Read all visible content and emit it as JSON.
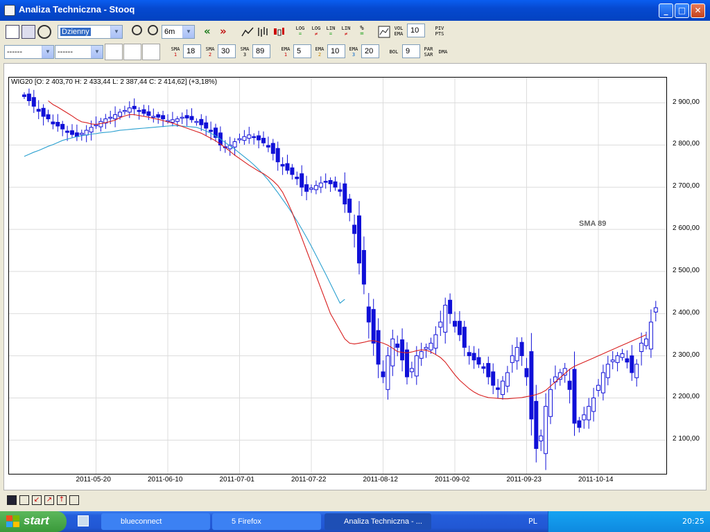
{
  "window": {
    "title": "Analiza Techniczna - Stooq"
  },
  "toolbar1": {
    "interval": "Dzienny",
    "range": "6m",
    "log_label": "LOG",
    "log_ne_label": "LOG",
    "lin_label": "LIN",
    "lin_ne_label": "LIN",
    "percent_label": "%",
    "vol_label": "VOL",
    "ema_label": "EMA",
    "vol_value": "10",
    "piv_label": "PIV",
    "pts_label": "PTS"
  },
  "toolbar2": {
    "combo1": "------",
    "combo2": "------",
    "sma_label": "SMA",
    "sma1_idx": "1",
    "sma1": "18",
    "sma2_idx": "2",
    "sma2": "30",
    "sma3_idx": "3",
    "sma3": "89",
    "ema_label": "EMA",
    "ema1_idx": "1",
    "ema1": "5",
    "ema2_idx": "2",
    "ema2": "10",
    "ema3_idx": "3",
    "ema3": "20",
    "bol_label": "BOL",
    "bol": "9",
    "par_label": "PAR",
    "sar_label": "SAR",
    "dma_label": "DMA"
  },
  "chart_data": {
    "type": "candlestick",
    "header": "WIG20 [O: 2 403,70  H: 2 433,44  L: 2 387,44  C: 2 414,62] (+3,18%)",
    "annotation": "SMA 89",
    "ylim": [
      2020,
      2960
    ],
    "y_ticks": [
      2900,
      2800,
      2700,
      2600,
      2500,
      2400,
      2300,
      2200,
      2100
    ],
    "y_tick_labels": [
      "2 900,00",
      "2 800,00",
      "2 700,00",
      "2 600,00",
      "2 500,00",
      "2 400,00",
      "2 300,00",
      "2 200,00",
      "2 100,00"
    ],
    "x_ticks": [
      "2011-05-20",
      "2011-06-10",
      "2011-07-01",
      "2011-07-22",
      "2011-08-12",
      "2011-09-02",
      "2011-09-23",
      "2011-10-14"
    ],
    "x_tick_index": [
      15,
      30,
      45,
      60,
      75,
      90,
      105,
      120
    ],
    "n_bars": 131,
    "grid": true,
    "colors": {
      "up": "#ffffff",
      "down": "#1010d8",
      "outline": "#1010d8",
      "sma_short": "#d81e1e",
      "sma89": "#2aa0d0"
    },
    "closes": [
      2915,
      2905,
      2892,
      2880,
      2868,
      2862,
      2850,
      2845,
      2838,
      2830,
      2825,
      2820,
      2828,
      2835,
      2842,
      2848,
      2856,
      2862,
      2866,
      2872,
      2878,
      2882,
      2888,
      2886,
      2880,
      2875,
      2870,
      2868,
      2866,
      2862,
      2858,
      2860,
      2862,
      2866,
      2864,
      2860,
      2856,
      2848,
      2840,
      2832,
      2818,
      2800,
      2795,
      2800,
      2808,
      2815,
      2820,
      2824,
      2818,
      2812,
      2805,
      2795,
      2780,
      2760,
      2750,
      2740,
      2730,
      2720,
      2700,
      2690,
      2698,
      2704,
      2710,
      2712,
      2708,
      2700,
      2690,
      2660,
      2640,
      2590,
      2520,
      2470,
      2380,
      2330,
      2280,
      2250,
      2300,
      2340,
      2320,
      2290,
      2250,
      2270,
      2300,
      2310,
      2320,
      2330,
      2350,
      2380,
      2420,
      2400,
      2370,
      2350,
      2320,
      2300,
      2290,
      2280,
      2270,
      2250,
      2230,
      2220,
      2240,
      2260,
      2300,
      2320,
      2300,
      2250,
      2150,
      2080,
      2110,
      2180,
      2220,
      2250,
      2260,
      2270,
      2220,
      2140,
      2130,
      2160,
      2180,
      2200,
      2230,
      2260,
      2280,
      2290,
      2300,
      2305,
      2285,
      2260,
      2280,
      2330,
      2340,
      2380,
      2414
    ],
    "sma_short": {
      "first_index": 5,
      "values": [
        2905,
        2896,
        2890,
        2883,
        2876,
        2869,
        2861,
        2855,
        2853,
        2850,
        2849,
        2851,
        2853,
        2856,
        2859,
        2865,
        2869,
        2872,
        2872,
        2870,
        2868,
        2866,
        2863,
        2861,
        2858,
        2855,
        2852,
        2848,
        2844,
        2840,
        2836,
        2832,
        2828,
        2822,
        2816,
        2810,
        2802,
        2794,
        2785,
        2776,
        2768,
        2760,
        2752,
        2745,
        2738,
        2732,
        2724,
        2715,
        2704,
        2688,
        2665,
        2640,
        2610,
        2580,
        2550,
        2520,
        2490,
        2460,
        2430,
        2400,
        2380,
        2360,
        2340,
        2330,
        2328,
        2330,
        2332,
        2335,
        2336,
        2333,
        2330,
        2325,
        2318,
        2310,
        2308,
        2307,
        2309,
        2312,
        2314,
        2313,
        2309,
        2303,
        2296,
        2285,
        2270,
        2255,
        2242,
        2232,
        2222,
        2214,
        2208,
        2204,
        2201,
        2200,
        2199,
        2198,
        2198,
        2199,
        2200,
        2201,
        2203,
        2205,
        2208,
        2212,
        2218,
        2228,
        2238,
        2248,
        2258,
        2268,
        2275,
        2280,
        2285,
        2290,
        2295,
        2300,
        2305,
        2310,
        2315,
        2320,
        2325,
        2330,
        2335,
        2340,
        2345,
        2350
      ]
    },
    "sma89": {
      "first_index": 0,
      "values": [
        2773,
        2778,
        2783,
        2787,
        2792,
        2797,
        2801,
        2806,
        2811,
        2814,
        2817,
        2820,
        2822,
        2824,
        2826,
        2827,
        2829,
        2830,
        2831,
        2833,
        2835,
        2836,
        2837,
        2838,
        2839,
        2840,
        2841,
        2842,
        2843,
        2844,
        2845,
        2846,
        2846,
        2845,
        2844,
        2843,
        2842,
        2838,
        2833,
        2828,
        2822,
        2814,
        2806,
        2798,
        2790,
        2781,
        2772,
        2763,
        2753,
        2742,
        2730,
        2717,
        2702,
        2687,
        2671,
        2655,
        2638,
        2620,
        2601,
        2581,
        2560,
        2538,
        2516,
        2494,
        2471,
        2448,
        2425,
        2434
      ]
    }
  },
  "statusbar": {},
  "taskbar": {
    "start_label": "start",
    "task1": "blueconnect",
    "task2": "5 Firefox",
    "task3": "Analiza Techniczna - ...",
    "lang": "PL",
    "clock": "20:25"
  }
}
